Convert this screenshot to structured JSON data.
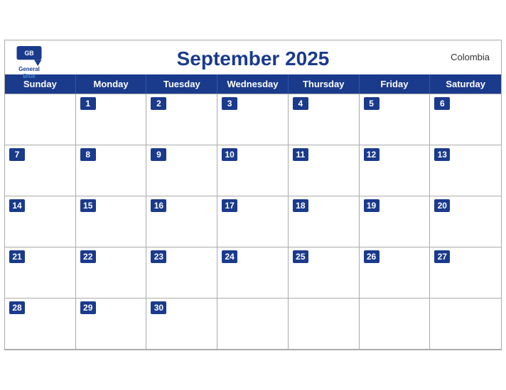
{
  "calendar": {
    "title": "September 2025",
    "country": "Colombia",
    "brand": {
      "name_general": "General",
      "name_blue": "Blue"
    },
    "days": [
      "Sunday",
      "Monday",
      "Tuesday",
      "Wednesday",
      "Thursday",
      "Friday",
      "Saturday"
    ],
    "weeks": [
      [
        null,
        1,
        2,
        3,
        4,
        5,
        6
      ],
      [
        7,
        8,
        9,
        10,
        11,
        12,
        13
      ],
      [
        14,
        15,
        16,
        17,
        18,
        19,
        20
      ],
      [
        21,
        22,
        23,
        24,
        25,
        26,
        27
      ],
      [
        28,
        29,
        30,
        null,
        null,
        null,
        null
      ]
    ]
  }
}
